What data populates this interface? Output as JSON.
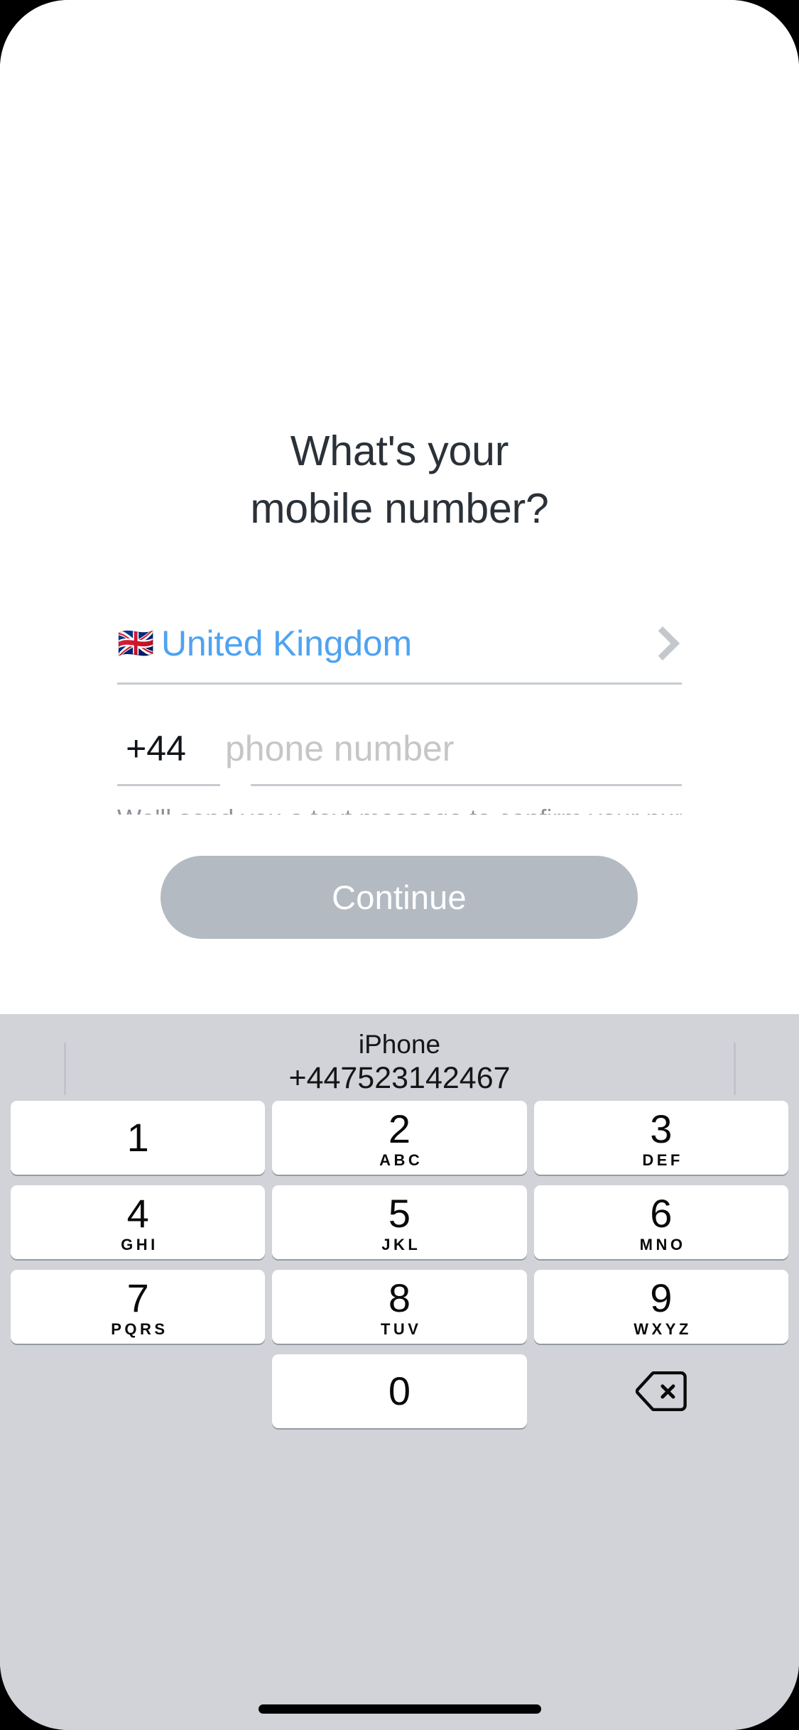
{
  "screen": {
    "title_line1": "What's your",
    "title_line2": "mobile number?"
  },
  "country_selector": {
    "flag": "🇬🇧",
    "flag_icon_name": "uk-flag-icon",
    "name": "United Kingdom",
    "chevron_icon_name": "chevron-right-icon",
    "accent_color": "#4fa3f0"
  },
  "phone_field": {
    "dial_code": "+44",
    "value": "",
    "placeholder": "phone number"
  },
  "hint": {
    "text": "We'll send you a text message to confirm your number."
  },
  "primary_action": {
    "label": "Continue",
    "enabled": false,
    "background_color": "#b4bac2",
    "text_color": "#ffffff"
  },
  "keyboard": {
    "background_color": "#d1d3d9",
    "suggestion": {
      "label": "iPhone",
      "number": "+447523142467"
    },
    "rows": [
      [
        {
          "digit": "1",
          "letters": ""
        },
        {
          "digit": "2",
          "letters": "ABC"
        },
        {
          "digit": "3",
          "letters": "DEF"
        }
      ],
      [
        {
          "digit": "4",
          "letters": "GHI"
        },
        {
          "digit": "5",
          "letters": "JKL"
        },
        {
          "digit": "6",
          "letters": "MNO"
        }
      ],
      [
        {
          "digit": "7",
          "letters": "PQRS"
        },
        {
          "digit": "8",
          "letters": "TUV"
        },
        {
          "digit": "9",
          "letters": "WXYZ"
        }
      ],
      [
        {
          "digit": "",
          "letters": "",
          "type": "blank"
        },
        {
          "digit": "0",
          "letters": ""
        },
        {
          "digit": "",
          "letters": "",
          "type": "delete",
          "icon": "backspace-icon"
        }
      ]
    ]
  },
  "system": {
    "home_indicator_color": "#000000"
  }
}
